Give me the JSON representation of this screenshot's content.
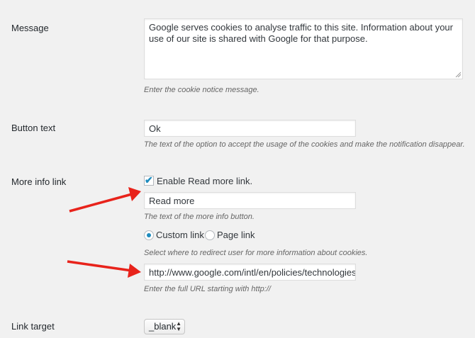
{
  "message": {
    "label": "Message",
    "value": "Google serves cookies to analyse traffic to this site. Information about your use of our site is shared with Google for that purpose.",
    "description": "Enter the cookie notice message."
  },
  "button_text": {
    "label": "Button text",
    "value": "Ok",
    "description": "The text of the option to accept the usage of the cookies and make the notification disappear."
  },
  "more_info": {
    "label": "More info link",
    "checkbox_label": "Enable Read more link.",
    "checkbox_checked": true,
    "button_value": "Read more",
    "button_description": "The text of the more info button.",
    "radio_custom_label": "Custom link",
    "radio_page_label": "Page link",
    "radio_selected": "Custom link",
    "redirect_description": "Select where to redirect user for more information about cookies.",
    "url_value": "http://www.google.com/intl/en/policies/technologies",
    "url_description": "Enter the full URL starting with http://"
  },
  "link_target": {
    "label": "Link target",
    "selected": "_blank"
  },
  "colors": {
    "accent": "#1e8cbe",
    "annotation_arrow": "#e8231b",
    "background": "#f1f1f1"
  }
}
